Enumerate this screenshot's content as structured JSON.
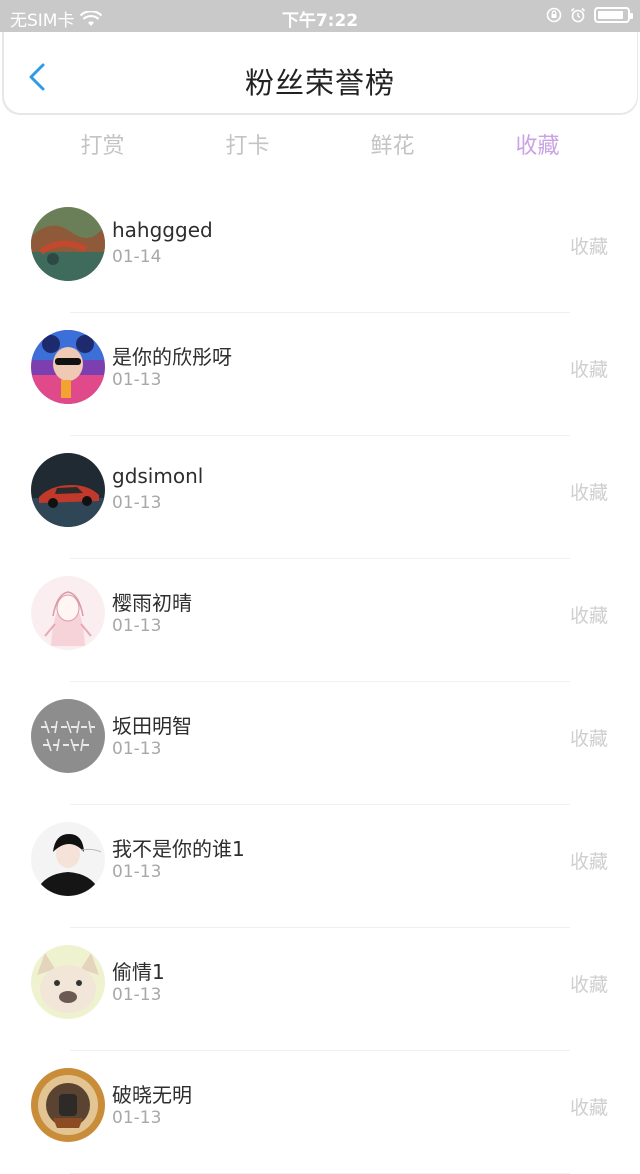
{
  "status_bar": {
    "carrier": "无SIM卡",
    "time": "下午7:22",
    "battery_level": 0.9
  },
  "header": {
    "title": "粉丝荣誉榜",
    "back_icon": "chevron-left-icon"
  },
  "tabs": [
    {
      "label": "打赏",
      "active": false
    },
    {
      "label": "打卡",
      "active": false
    },
    {
      "label": "鲜花",
      "active": false
    },
    {
      "label": "收藏",
      "active": true
    }
  ],
  "colors": {
    "accent": "#c9a3e2",
    "back_arrow": "#2e9be6",
    "status_bar": "#c9c9c9",
    "muted_text": "#a8a8a8"
  },
  "fans": [
    {
      "name": "hahggged",
      "date": "01-14",
      "action": "收藏",
      "avatar": "landscape-avatar"
    },
    {
      "name": "是你的欣彤呀",
      "date": "01-13",
      "action": "收藏",
      "avatar": "girl-sunglasses-avatar"
    },
    {
      "name": "gdsimonl",
      "date": "01-13",
      "action": "收藏",
      "avatar": "car-avatar"
    },
    {
      "name": "樱雨初晴",
      "date": "01-13",
      "action": "收藏",
      "avatar": "anime-girl-avatar"
    },
    {
      "name": "坂田明智",
      "date": "01-13",
      "action": "收藏",
      "avatar": "text-avatar"
    },
    {
      "name": "我不是你的谁1",
      "date": "01-13",
      "action": "收藏",
      "avatar": "dark-hair-boy-avatar"
    },
    {
      "name": "偷情1",
      "date": "01-13",
      "action": "收藏",
      "avatar": "bulldog-avatar"
    },
    {
      "name": "破晓无明",
      "date": "01-13",
      "action": "收藏",
      "avatar": "warrior-avatar"
    }
  ]
}
